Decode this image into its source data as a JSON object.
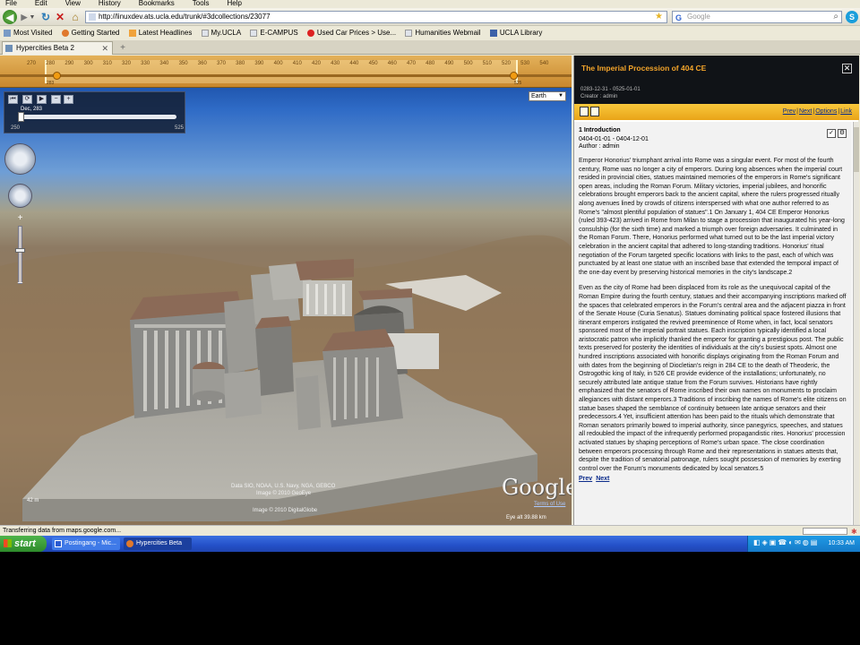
{
  "browser": {
    "menu": [
      "File",
      "Edit",
      "View",
      "History",
      "Bookmarks",
      "Tools",
      "Help"
    ],
    "url": "http://linuxdev.ats.ucla.edu/trunk/#3dcollections/23077",
    "search_placeholder": "Google",
    "bookmarks": [
      "Most Visited",
      "Getting Started",
      "Latest Headlines",
      "My.UCLA",
      "E-CAMPUS",
      "Used Car Prices > Use...",
      "Humanities Webmail",
      "UCLA Library"
    ],
    "tab_title": "Hypercities Beta 2",
    "new_tab": "+",
    "status": "Transferring data from maps.google.com..."
  },
  "timeline": {
    "ticks": [
      "270",
      "280",
      "290",
      "300",
      "310",
      "320",
      "330",
      "340",
      "350",
      "360",
      "370",
      "380",
      "390",
      "400",
      "410",
      "420",
      "430",
      "440",
      "450",
      "460",
      "470",
      "480",
      "490",
      "500",
      "510",
      "520",
      "530",
      "540"
    ],
    "start_label": "283",
    "end_label": "525"
  },
  "controls": {
    "slider_label": "Dec, 283",
    "slider_min": "250",
    "slider_max": "525",
    "globe_select": "Earth"
  },
  "map": {
    "attribution_line1": "Data SIO, NOAA, U.S. Navy, NGA, GEBCO",
    "attribution_line2": "Image © 2010 GeoEye",
    "attribution_line3": "Image © 2010 DigitalGlobe",
    "logo": "Google",
    "terms": "Terms of Use",
    "scale": "42 m",
    "eye_alt": "Eye alt   39.88 km"
  },
  "panel": {
    "title": "The Imperial Procession of 404 CE",
    "meta_dates": "0283-12-31 - 0525-01-01",
    "meta_creator": "Creator : admin",
    "links": [
      "Prev",
      "Next",
      "Options",
      "Link"
    ],
    "section_title": "1 Introduction",
    "section_dates": "0404-01-01 - 0404-12-01",
    "section_author": "Author : admin",
    "paragraph1": "Emperor Honorius' triumphant arrival into Rome was a singular event.  For most of the fourth century, Rome was no longer a city of emperors.  During long absences when the imperial court resided in provincial cities, statues maintained memories of the emperors in Rome's significant open areas, including the Roman Forum.  Military victories, imperial jubilees, and honorific celebrations brought emperors back to the ancient capital, where the rulers progressed ritually along avenues lined by crowds of citizens interspersed with what one author referred to as Rome's \"almost plentiful population of statues\".1  On January 1, 404 CE Emperor Honorius (ruled 393-423) arrived in Rome from Milan to stage a procession that inaugurated his year-long consulship (for the sixth time) and marked a triumph over foreign adversaries.  It culminated in the Roman Forum.  There, Honorius performed what turned out to be the last imperial victory celebration in the ancient capital that adhered to long-standing traditions.  Honorius' ritual negotiation of the Forum targeted specific locations with links to the past, each of which was punctuated by at least one statue with an inscribed base that extended the temporal impact of the one-day event by preserving historical memories in the city's landscape.2",
    "paragraph2": "Even as the city of Rome had been displaced from its role as the unequivocal capital of the Roman Empire during the fourth century, statues and their accompanying inscriptions marked off the spaces that celebrated emperors in the Forum's central area and the adjacent piazza in front of the Senate House (Curia Senatus).  Statues dominating political space fostered illusions that itinerant emperors instigated the revived preeminence of Rome when, in fact, local senators sponsored most of the imperial portrait statues.  Each inscription typically identified a local aristocratic patron who implicitly thanked the emperor for granting a prestigious post.  The public texts preserved for posterity the identities of individuals at the city's busiest spots.  Almost one hundred inscriptions associated with honorific displays originating from the Roman Forum and with dates from the beginning of Diocletian's reign in 284 CE to the death of Theoderic, the Ostrogothic king of Italy, in 526 CE provide evidence of the installations; unfortunately, no securely attributed late antique statue from the Forum survives.  Historians have rightly emphasized that the senators of Rome inscribed their own names on monuments to proclaim allegiances with distant emperors.3  Traditions of inscribing the names of Rome's elite citizens on statue bases shaped the semblance of continuity between late antique senators and their predecessors.4  Yet, insufficient attention has been paid to the rituals which demonstrate that Roman senators primarily bowed to imperial authority, since panegyrics, speeches, and statues all redoubled the impact of the infrequently performed propagandistic rites.  Honorius' procession activated statues by shaping perceptions of Rome's urban space.  The close coordination between emperors processing through Rome and their representations in statues attests that, despite the tradition of senatorial patronage, rulers sought possession of memories by exerting control over the Forum's monuments dedicated by local senators.5",
    "bottom_prev": "Prev",
    "bottom_next": "Next"
  },
  "taskbar": {
    "start": "start",
    "items": [
      "Postingang - Mic...",
      "Hypercities Beta 2..."
    ],
    "clock": "10:33 AM"
  }
}
